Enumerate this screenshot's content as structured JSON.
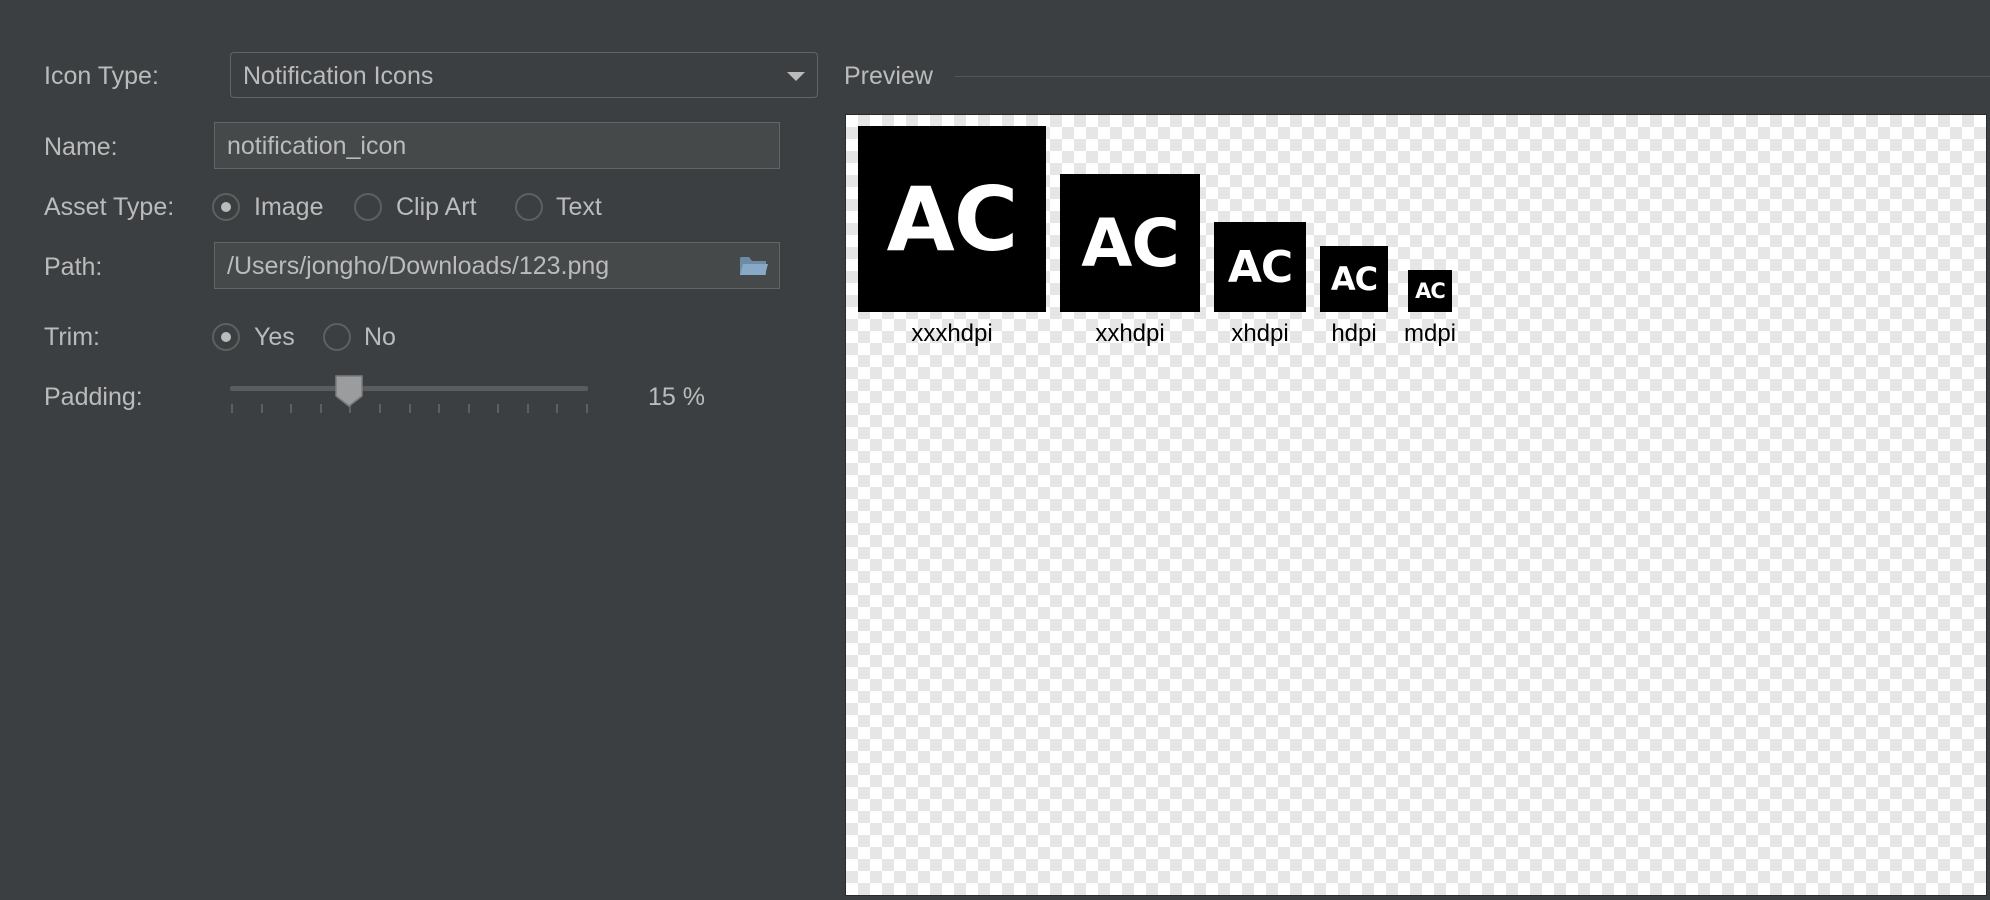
{
  "form": {
    "icon_type": {
      "label": "Icon Type:",
      "value": "Notification Icons"
    },
    "name": {
      "label": "Name:",
      "value": "notification_icon"
    },
    "asset_type": {
      "label": "Asset Type:",
      "options": [
        "Image",
        "Clip Art",
        "Text"
      ],
      "selected": "Image"
    },
    "path": {
      "label": "Path:",
      "value": "/Users/jongho/Downloads/123.png",
      "icon": "folder-icon"
    },
    "trim": {
      "label": "Trim:",
      "options": [
        "Yes",
        "No"
      ],
      "selected": "Yes"
    },
    "padding": {
      "label": "Padding:",
      "value": "15 %",
      "percent": 15
    }
  },
  "preview": {
    "title": "Preview",
    "icon_text": "AC",
    "densities": [
      "xxxhdpi",
      "xxhdpi",
      "xhdpi",
      "hdpi",
      "mdpi"
    ]
  }
}
